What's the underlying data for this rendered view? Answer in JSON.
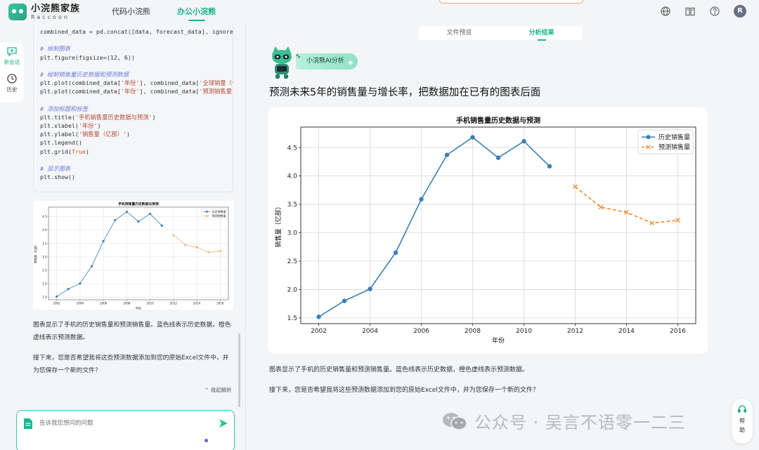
{
  "app": {
    "logo_cn": "小浣熊家族",
    "logo_en": "Raccoon",
    "nav": [
      {
        "label": "代码小浣熊",
        "active": false
      },
      {
        "label": "办公小浣熊",
        "active": true
      }
    ],
    "avatar_letter": "R",
    "top_icons": [
      "globe-icon",
      "book-icon",
      "help-circle-icon"
    ]
  },
  "rail": [
    {
      "label": "新会话",
      "icon": "new-chat-icon",
      "active": true
    },
    {
      "label": "历史",
      "icon": "history-icon",
      "active": false
    }
  ],
  "left": {
    "code_lines": [
      "combined_data = pd.concat([data, forecast_data], ignore_ind",
      "",
      "# 绘制图表",
      "plt.figure(figsize=(12, 6))",
      "",
      "# 绘制销售量历史数据和预测数据",
      "plt.plot(combined_data['年份'], combined_data['全球销量（亿",
      "plt.plot(combined_data['年份'], combined_data['预测销售量（",
      "",
      "# 添加标题和标签",
      "plt.title('手机销售量历史数据与预测')",
      "plt.xlabel('年份')",
      "plt.ylabel('销售量（亿部）')",
      "plt.legend()",
      "plt.grid(True)",
      "",
      "# 显示图表",
      "plt.show()"
    ],
    "paragraphs": [
      "图表显示了手机的历史销售量和预测销售量。蓝色线表示历史数据，橙色虚线表示预测数据。",
      "接下来，您是否希望我将这些预测数据添加到您的原始Excel文件中，并为您保存一个新的文件？"
    ],
    "collapse_label": "收起解析",
    "input_placeholder": "告诉我您想问的问题"
  },
  "right": {
    "tabs": [
      {
        "label": "文件预览",
        "active": false
      },
      {
        "label": "分析结果",
        "active": true
      }
    ],
    "ai_badge": "小浣熊AI分析",
    "question": "预测未来5年的销售量与增长率，把数据加在已有的图表后面",
    "paragraphs": [
      "图表显示了手机的历史销售量和预测销售量。蓝色线表示历史数据，橙色虚线表示预测数据。",
      "接下来，您是否希望我将这些预测数据添加到您的原始Excel文件中，并为您保存一个新的文件？"
    ],
    "watermark": "公众号 · 吴言不语零一二三",
    "help_label": "帮助"
  },
  "colors": {
    "accent": "#20b08a",
    "history_line": "#3b7fb4",
    "forecast_line": "#f08a2c"
  },
  "chart_data": {
    "type": "line",
    "title": "手机销售量历史数据与预测",
    "xlabel": "年份",
    "ylabel": "销售量（亿部）",
    "xlim": [
      2001.3,
      2016.7
    ],
    "ylim": [
      1.4,
      4.86
    ],
    "xticks": [
      2002,
      2004,
      2006,
      2008,
      2010,
      2012,
      2014,
      2016
    ],
    "yticks": [
      1.5,
      2.0,
      2.5,
      3.0,
      3.5,
      4.0,
      4.5
    ],
    "ytick_labels": [
      "1.5",
      "2.0",
      "2.5",
      "3.0",
      "3.5",
      "4.0",
      "4.5"
    ],
    "grid": true,
    "legend_position": "top-right",
    "series": [
      {
        "name": "历史销售量",
        "style": "solid-circle",
        "x": [
          2002,
          2003,
          2004,
          2005,
          2006,
          2007,
          2008,
          2009,
          2010,
          2011
        ],
        "y": [
          1.52,
          1.8,
          2.01,
          2.65,
          3.59,
          4.37,
          4.68,
          4.32,
          4.61,
          4.17
        ]
      },
      {
        "name": "预测销售量",
        "style": "dashed-x",
        "x": [
          2012,
          2013,
          2014,
          2015,
          2016
        ],
        "y": [
          3.81,
          3.45,
          3.36,
          3.17,
          3.22
        ]
      }
    ]
  }
}
